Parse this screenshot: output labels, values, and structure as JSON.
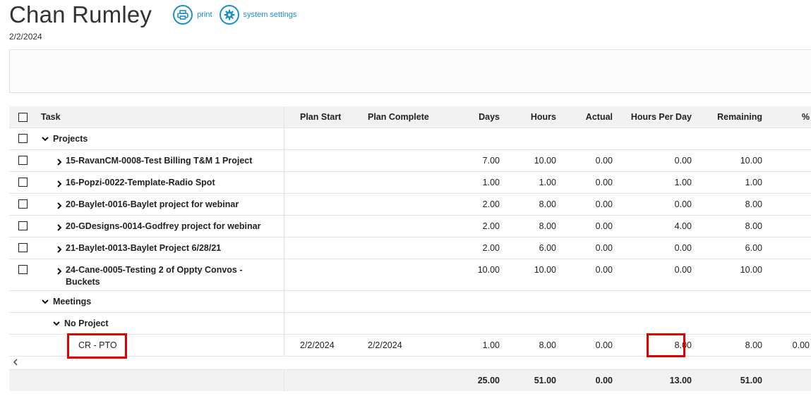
{
  "header": {
    "title": "Chan Rumley",
    "date": "2/2/2024",
    "print_label": "print",
    "settings_label": "system settings",
    "accent": "#1a8fc9"
  },
  "columns": {
    "task": "Task",
    "plan_start": "Plan Start",
    "plan_complete": "Plan Complete",
    "days": "Days",
    "hours": "Hours",
    "actual": "Actual",
    "hours_per_day": "Hours Per Day",
    "remaining": "Remaining",
    "pct": "%"
  },
  "rows": [
    {
      "label": "Projects",
      "days": "",
      "hours": "",
      "actual": "",
      "hpd": "",
      "remaining": ""
    },
    {
      "label": "15-RavanCM-0008-Test Billing T&M 1 Project",
      "days": "7.00",
      "hours": "10.00",
      "actual": "0.00",
      "hpd": "0.00",
      "remaining": "10.00"
    },
    {
      "label": "16-Popzi-0022-Template-Radio Spot",
      "days": "1.00",
      "hours": "1.00",
      "actual": "0.00",
      "hpd": "1.00",
      "remaining": "1.00"
    },
    {
      "label": "20-Baylet-0016-Baylet project for webinar",
      "days": "2.00",
      "hours": "8.00",
      "actual": "0.00",
      "hpd": "0.00",
      "remaining": "8.00"
    },
    {
      "label": "20-GDesigns-0014-Godfrey project for webinar",
      "days": "2.00",
      "hours": "8.00",
      "actual": "0.00",
      "hpd": "4.00",
      "remaining": "8.00"
    },
    {
      "label": "21-Baylet-0013-Baylet Project 6/28/21",
      "days": "2.00",
      "hours": "6.00",
      "actual": "0.00",
      "hpd": "0.00",
      "remaining": "6.00"
    },
    {
      "label": "24-Cane-0005-Testing 2 of Oppty Convos - Buckets",
      "days": "10.00",
      "hours": "10.00",
      "actual": "0.00",
      "hpd": "0.00",
      "remaining": "10.00"
    },
    {
      "label": "Meetings"
    },
    {
      "label": "No Project"
    },
    {
      "label": "CR - PTO",
      "plan_start": "2/2/2024",
      "plan_complete": "2/2/2024",
      "days": "1.00",
      "hours": "8.00",
      "actual": "0.00",
      "hpd": "8.00",
      "remaining": "8.00",
      "pct": "0.00"
    }
  ],
  "totals": {
    "days": "25.00",
    "hours": "51.00",
    "actual": "0.00",
    "hpd": "13.00",
    "remaining": "51.00"
  },
  "highlight_color": "#e00000"
}
